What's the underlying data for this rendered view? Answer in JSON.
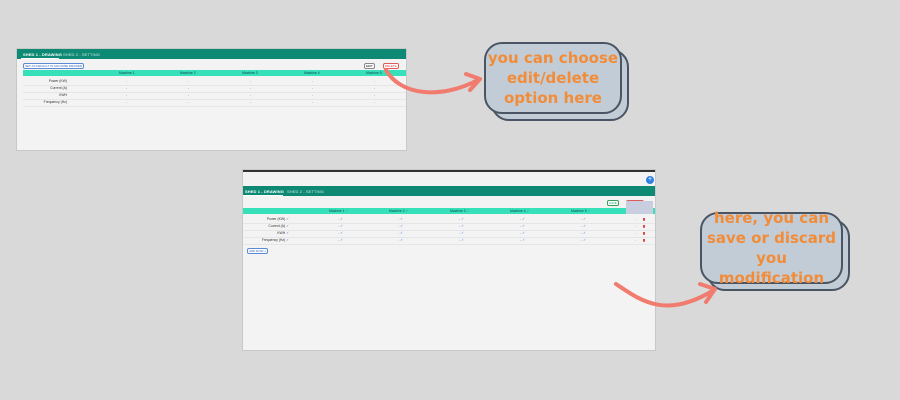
{
  "shot1": {
    "tabs": [
      "SHED 1 - DRAWING",
      "SHED 2 - SETTING"
    ],
    "default_button": "SET AS DEFAULT IN MACHINE DRAWER",
    "edit_button": "EDIT",
    "delete_button": "DELETE",
    "columns": [
      "Machine 1",
      "Machine 2",
      "Machine 3",
      "Machine 4",
      "Machine 5"
    ],
    "rows": [
      "Power (KW)",
      "Current (A)",
      "KWH",
      "Frequency (Hz)"
    ],
    "empty_value": "-"
  },
  "shot2": {
    "tabs": [
      "SHED 1 - DRAWING",
      "SHED 2 - SETTING"
    ],
    "save_button": "SAVE",
    "discard_button": "DISCARD",
    "columns": [
      "Machine 1",
      "Machine 2",
      "Machine 3",
      "Machine 4",
      "Machine 5"
    ],
    "rows": [
      "Power (KW)",
      "Current (A)",
      "KWH",
      "Frequency (Hz)"
    ],
    "empty_value": "-",
    "add_row_button": "ADD ROW +",
    "fab_label": "+"
  },
  "callouts": {
    "edit_delete": "you can choose edit/delete option here",
    "save_discard": "here, you can save or discard you modification"
  },
  "colors": {
    "header_teal": "#0e8a74",
    "table_header_mint": "#36e0b8",
    "callout_text": "#f28c38",
    "arrow": "#f07b6e"
  }
}
